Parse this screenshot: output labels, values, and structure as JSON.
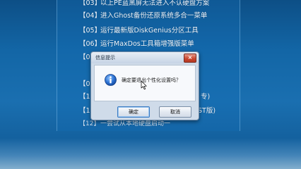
{
  "menu": {
    "items": [
      {
        "num": "【03】",
        "label": "以上PE蓝黑屏无法进入不认硬盘方案"
      },
      {
        "num": "【04】",
        "label": "进入Ghost备份还原系统多合一菜单"
      },
      {
        "num": "【05】",
        "label": "运行最新版DiskGenius分区工具"
      },
      {
        "num": "【06】",
        "label": "运行MaxDos工具箱增强版菜单"
      },
      {
        "num": "【0",
        "label": ""
      },
      {
        "num": "【0",
        "label": ""
      },
      {
        "num": "【1",
        "label": "",
        "tail": "专)"
      },
      {
        "num": "【1",
        "label": "",
        "tail": "ST版)"
      },
      {
        "num": "【12】",
        "label": "一尝试从本地硬盘启动一"
      }
    ]
  },
  "dialog": {
    "title": "信息提示",
    "close_label": "×",
    "message": "确定要退出个性化设置吗？",
    "ok_label": "确定",
    "cancel_label": "取消",
    "icon": "info-icon"
  },
  "colors": {
    "background": "#1366a6",
    "dialog_frame": "#cfdbe9",
    "close_button": "#c7432c"
  }
}
